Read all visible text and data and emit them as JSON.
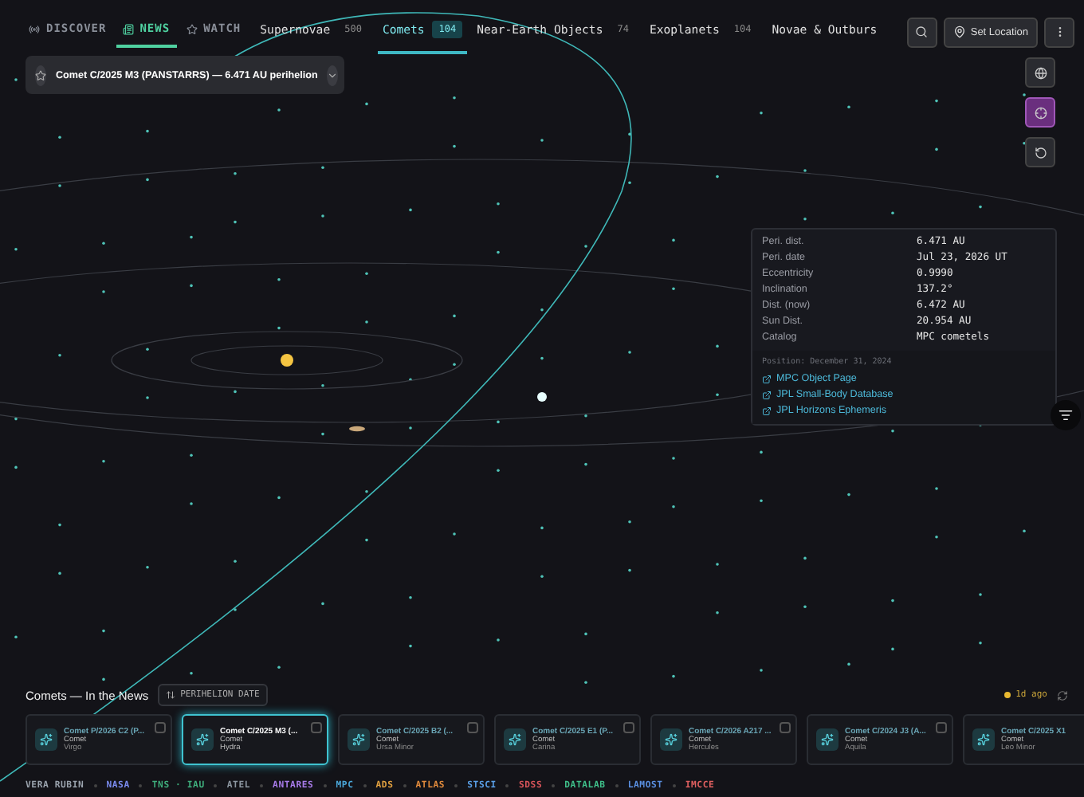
{
  "modes": [
    {
      "label": "DISCOVER",
      "selected": false,
      "kind": "radio"
    },
    {
      "label": "NEWS",
      "selected": true,
      "kind": "news"
    },
    {
      "label": "WATCH",
      "selected": false,
      "kind": "star"
    }
  ],
  "categories": [
    {
      "label": "Supernovae",
      "count": "500",
      "selected": false
    },
    {
      "label": "Comets",
      "count": "104",
      "selected": true
    },
    {
      "label": "Near-Earth Objects",
      "count": "74",
      "selected": false
    },
    {
      "label": "Exoplanets",
      "count": "104",
      "selected": false
    },
    {
      "label": "Novae & Outburs",
      "selected": false
    }
  ],
  "location_button": "Set Location",
  "side_tools": [
    {
      "kind": "globe",
      "selected": false
    },
    {
      "kind": "target",
      "selected": true
    },
    {
      "kind": "reset",
      "selected": false
    }
  ],
  "highlight": {
    "title": "Comet C/2025 M3 (PANSTARRS) — 6.471 AU perihelion",
    "starred": false
  },
  "details": {
    "rows": [
      {
        "label": "Peri. dist.",
        "value": "6.471 AU"
      },
      {
        "label": "Peri. date",
        "value": "Jul 23, 2026 UT"
      },
      {
        "label": "Eccentricity",
        "value": "0.9990"
      },
      {
        "label": "Inclination",
        "value": "137.2°"
      },
      {
        "label": "Dist. (now)",
        "value": "6.472 AU"
      },
      {
        "label": "Sun Dist.",
        "value": "20.954 AU"
      },
      {
        "label": "Catalog",
        "value": "MPC cometels"
      }
    ],
    "position": "Position: December 31, 2024",
    "links": [
      "MPC Object Page",
      "JPL Small-Body Database",
      "JPL Horizons Ephemeris"
    ]
  },
  "news": {
    "title": "Comets — In the News",
    "sort": "PERIHELION DATE",
    "updated": "1d ago",
    "cards": [
      {
        "name": "Comet P/2026 C2 (P...",
        "type": "Comet",
        "constellation": "Virgo",
        "selected": false
      },
      {
        "name": "Comet C/2025 M3 (...",
        "type": "Comet",
        "constellation": "Hydra",
        "selected": true
      },
      {
        "name": "Comet C/2025 B2 (...",
        "type": "Comet",
        "constellation": "Ursa Minor",
        "selected": false
      },
      {
        "name": "Comet C/2025 E1 (P...",
        "type": "Comet",
        "constellation": "Carina",
        "selected": false
      },
      {
        "name": "Comet C/2026 A217 ...",
        "type": "Comet",
        "constellation": "Hercules",
        "selected": false
      },
      {
        "name": "Comet C/2024 J3 (A...",
        "type": "Comet",
        "constellation": "Aquila",
        "selected": false
      },
      {
        "name": "Comet C/2025 X1",
        "type": "Comet",
        "constellation": "Leo Minor",
        "selected": false
      }
    ]
  },
  "sources": [
    {
      "label": "VERA RUBIN",
      "color": "#9aa3ad"
    },
    {
      "label": "NASA",
      "color": "#7b8cf0"
    },
    {
      "label": "TNS · IAU",
      "color": "#3fae7c"
    },
    {
      "label": "ATEL",
      "color": "#8c96a0"
    },
    {
      "label": "ANTARES",
      "color": "#a77be8"
    },
    {
      "label": "MPC",
      "color": "#4aa6d8"
    },
    {
      "label": "ADS",
      "color": "#e0a040"
    },
    {
      "label": "ATLAS",
      "color": "#e08a3c"
    },
    {
      "label": "STSCI",
      "color": "#5aa0e8"
    },
    {
      "label": "SDSS",
      "color": "#d8545a"
    },
    {
      "label": "DATALAB",
      "color": "#3fbf8a"
    },
    {
      "label": "LAMOST",
      "color": "#5a8fe0"
    },
    {
      "label": "IMCCE",
      "color": "#e06060"
    }
  ]
}
